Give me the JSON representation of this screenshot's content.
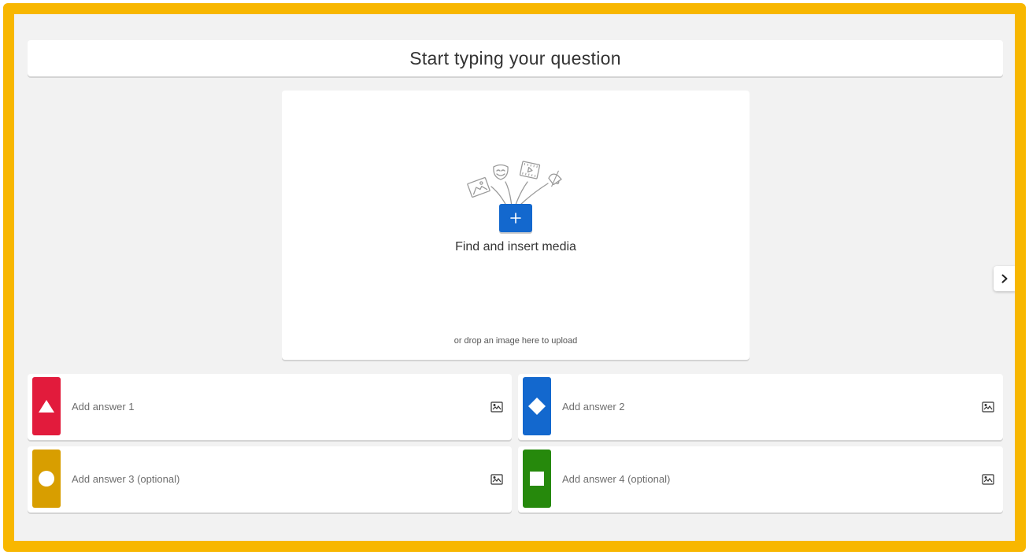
{
  "question": {
    "placeholder": "Start typing your question"
  },
  "media": {
    "title": "Find and insert media",
    "hint": "or drop an image here to upload",
    "add_button_icon": "plus-icon",
    "add_button_color": "#1368ce"
  },
  "navigation": {
    "next_icon": "chevron-right-icon"
  },
  "answers": [
    {
      "label": "Add answer 1",
      "shape": "triangle-icon",
      "color": "#e21b3c",
      "image_icon": "image-icon"
    },
    {
      "label": "Add answer 2",
      "shape": "diamond-icon",
      "color": "#1368ce",
      "image_icon": "image-icon"
    },
    {
      "label": "Add answer 3 (optional)",
      "shape": "circle-icon",
      "color": "#d89e00",
      "image_icon": "image-icon"
    },
    {
      "label": "Add answer 4 (optional)",
      "shape": "square-icon",
      "color": "#26890c",
      "image_icon": "image-icon"
    }
  ],
  "theme": {
    "frame_color": "#f8b700",
    "background": "#f2f2f2"
  }
}
